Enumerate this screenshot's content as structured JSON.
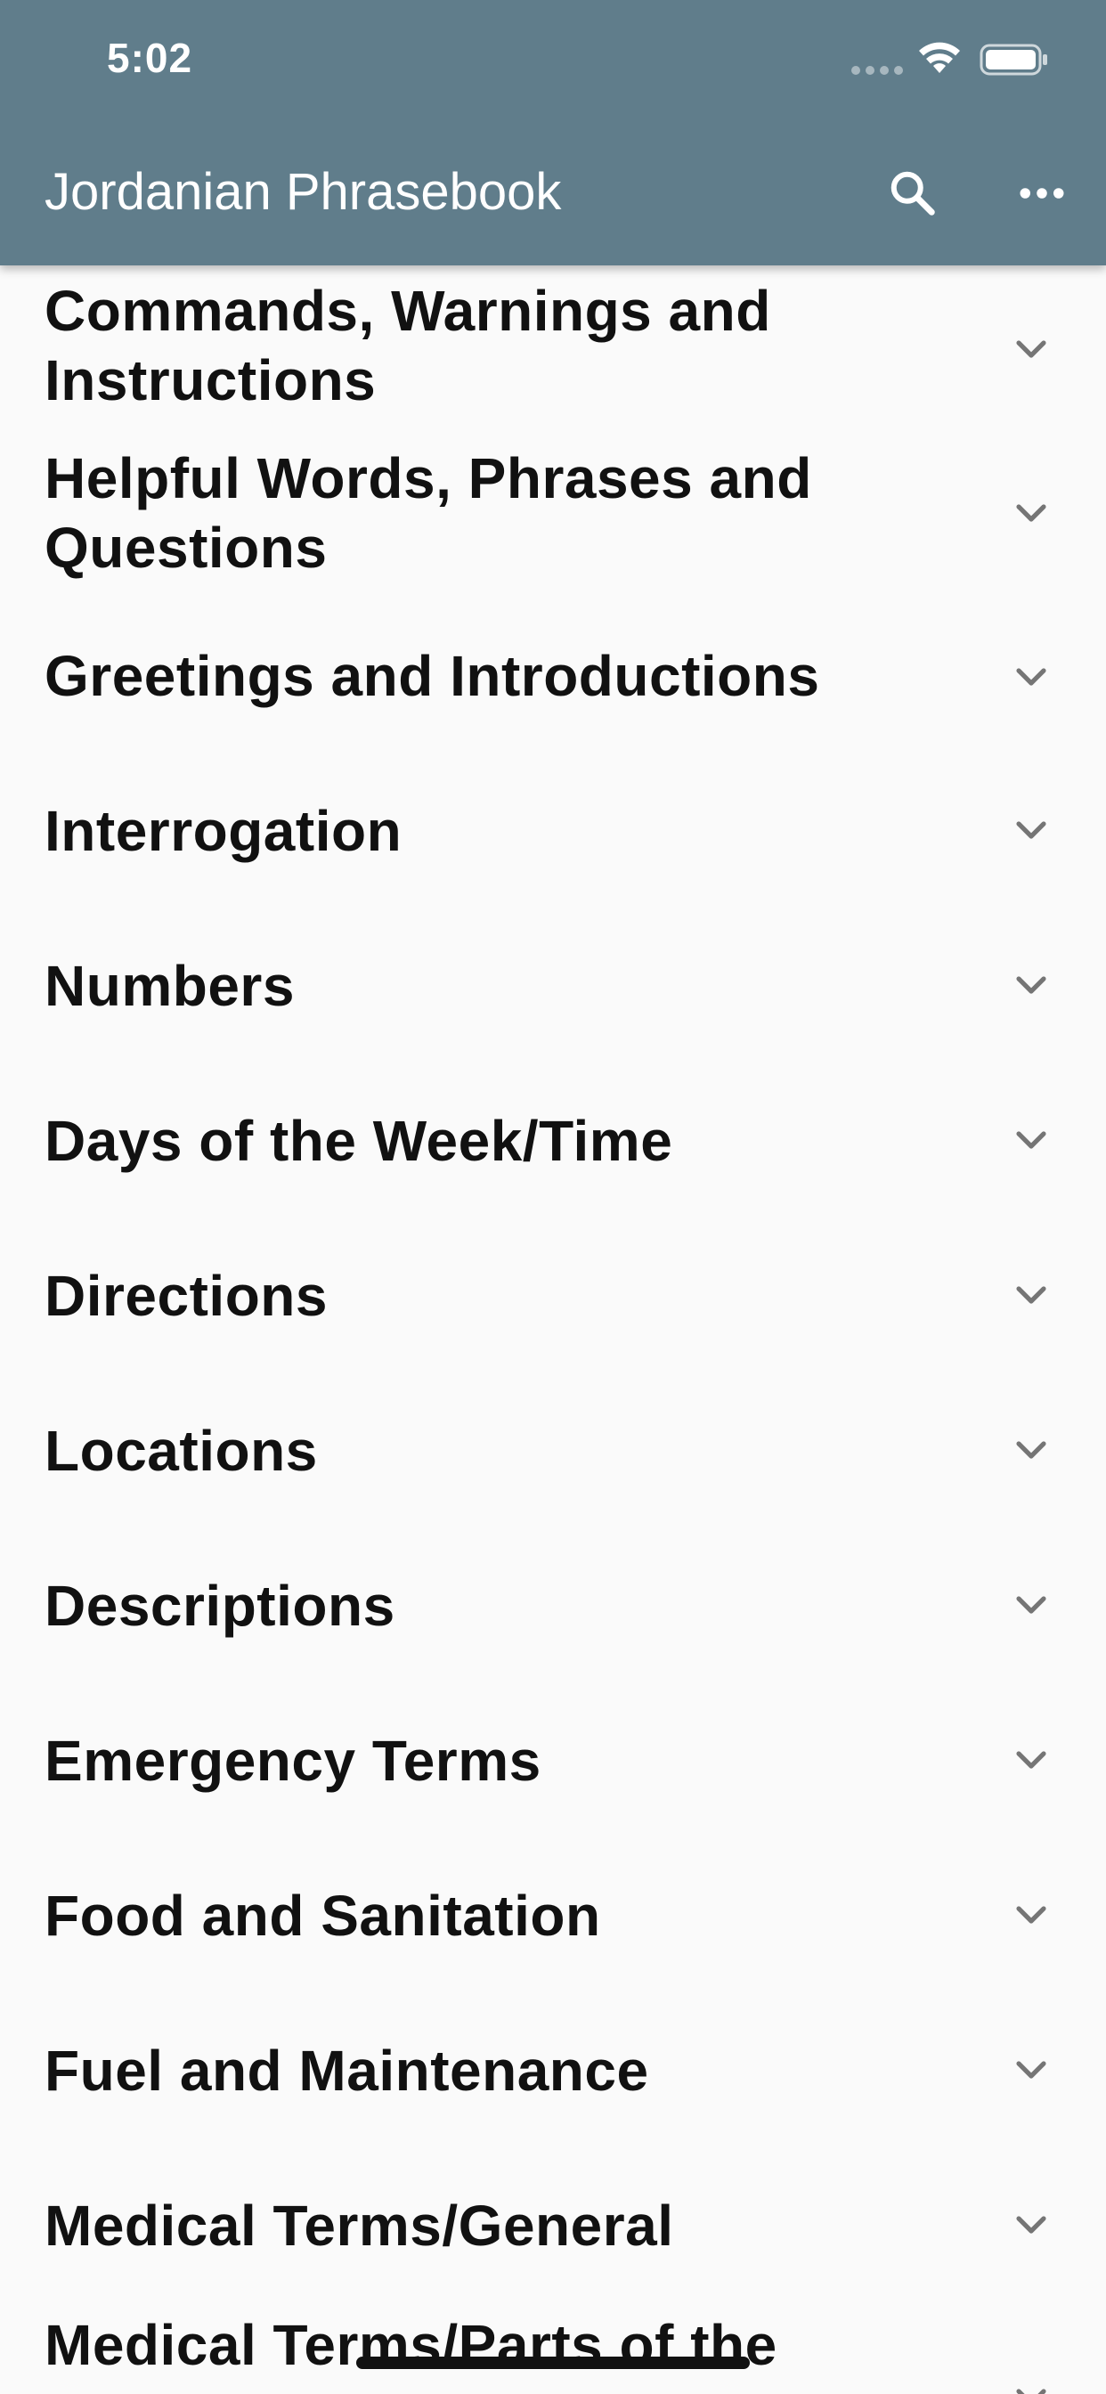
{
  "status_bar": {
    "time": "5:02"
  },
  "toolbar": {
    "title": "Jordanian Phrasebook",
    "search_icon": "search-icon",
    "more_icon": "more-horizontal-icon"
  },
  "colors": {
    "app_bar": "#607d8b",
    "background": "#fafafa",
    "text": "#111111",
    "chevron": "#757575"
  },
  "categories": [
    {
      "label": "Commands, Warnings and Instructions",
      "icon": "chevron-down-icon"
    },
    {
      "label": "Helpful Words, Phrases and Questions",
      "icon": "chevron-down-icon"
    },
    {
      "label": "Greetings and Introductions",
      "icon": "chevron-down-icon"
    },
    {
      "label": "Interrogation",
      "icon": "chevron-down-icon"
    },
    {
      "label": "Numbers",
      "icon": "chevron-down-icon"
    },
    {
      "label": "Days of the Week/Time",
      "icon": "chevron-down-icon"
    },
    {
      "label": "Directions",
      "icon": "chevron-down-icon"
    },
    {
      "label": "Locations",
      "icon": "chevron-down-icon"
    },
    {
      "label": "Descriptions",
      "icon": "chevron-down-icon"
    },
    {
      "label": "Emergency Terms",
      "icon": "chevron-down-icon"
    },
    {
      "label": "Food and Sanitation",
      "icon": "chevron-down-icon"
    },
    {
      "label": "Fuel and Maintenance",
      "icon": "chevron-down-icon"
    },
    {
      "label": "Medical Terms/General",
      "icon": "chevron-down-icon"
    },
    {
      "label": "Medical Terms/Parts of the",
      "icon": "chevron-down-icon"
    }
  ]
}
